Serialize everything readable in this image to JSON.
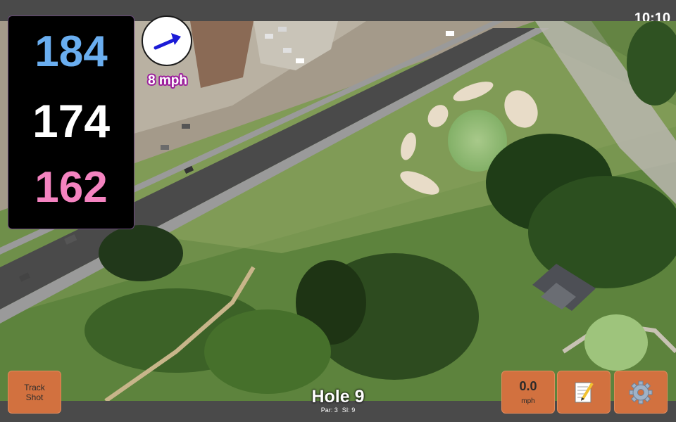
{
  "status": {
    "time": "10:10"
  },
  "distances": {
    "back": "184",
    "middle": "174",
    "front": "162",
    "colors": {
      "back": "#6aaef0",
      "middle": "#ffffff",
      "front": "#f483c0"
    }
  },
  "wind": {
    "speed_label": "8 mph",
    "icon": "wind-direction-arrow-icon",
    "arrow_color": "#1b1bd6"
  },
  "track_shot": {
    "label": "Track\nShot"
  },
  "speed": {
    "value": "0.0",
    "unit": "mph"
  },
  "hole": {
    "title": "Hole 9",
    "par_label": "Par: 3",
    "si_label": "SI: 9"
  },
  "toolbar": {
    "notes_icon": "notepad-pencil-icon",
    "settings_icon": "gear-icon"
  },
  "theme": {
    "button_color": "#d2713f",
    "panel_color": "#000000",
    "bar_color": "#4a4a4a"
  }
}
